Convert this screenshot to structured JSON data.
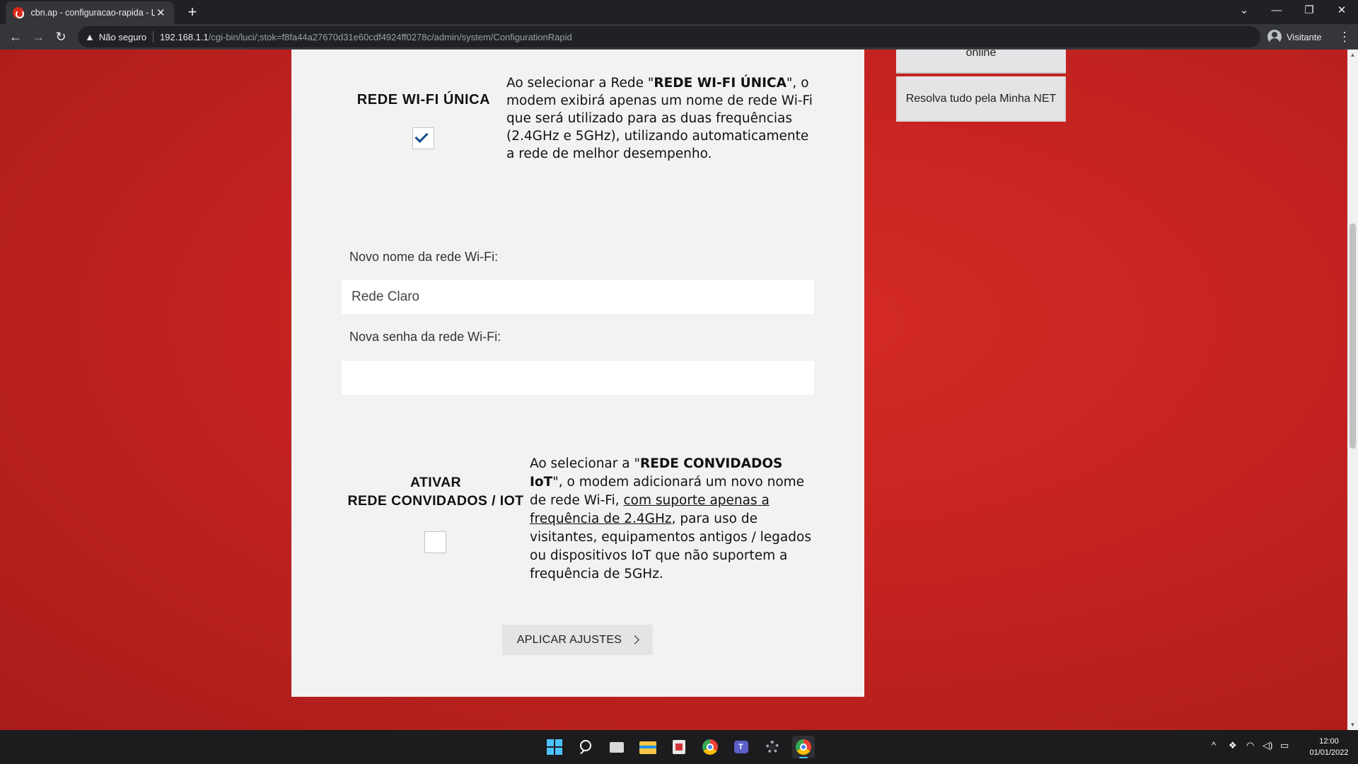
{
  "browser": {
    "tab_title": "cbn.ap - configuracao-rapida - LuCI",
    "tab_close": "✕",
    "new_tab": "+",
    "security_label": "Não seguro",
    "url_host": "192.168.1.1",
    "url_path": "/cgi-bin/luci/;stok=f8fa44a27670d31e60cdf4924ff0278c/admin/system/ConfigurationRapid",
    "profile_label": "Visitante"
  },
  "sidebar": {
    "top_item": "online",
    "link_label": "Resolva tudo pela Minha NET"
  },
  "unique_wifi": {
    "title": "REDE WI-FI ÚNICA",
    "checked": true,
    "desc_prefix": "Ao selecionar a Rede \"",
    "desc_bold": "REDE WI-FI ÚNICA",
    "desc_suffix": "\", o modem exibirá apenas um nome de rede Wi-Fi que será utilizado para as duas frequências (2.4GHz e 5GHz), utilizando automaticamente a rede de melhor desempenho."
  },
  "form": {
    "ssid_label": "Novo nome da rede Wi-Fi:",
    "ssid_value": "Rede Claro",
    "password_label": "Nova senha da rede Wi-Fi:",
    "password_value": ""
  },
  "guest_iot": {
    "title_line1": "ATIVAR",
    "title_line2": "REDE CONVIDADOS / IOT",
    "checked": false,
    "desc_prefix": "Ao selecionar a \"",
    "desc_bold": "REDE CONVIDADOS IoT",
    "desc_mid": "\", o modem adicionará um novo nome de rede Wi-Fi, ",
    "desc_underline": "com suporte apenas a frequência de 2.4GHz",
    "desc_suffix": ", para uso de visitantes, equipamentos antigos / legados ou dispositivos IoT que não suportem a frequência de 5GHz."
  },
  "apply_button": "APLICAR AJUSTES",
  "taskbar": {
    "time": "12:00",
    "date": "01/01/2022"
  },
  "colors": {
    "page_background": "#c42320",
    "card": "#f2f2f2",
    "check_mark": "#134a8e",
    "button": "#e4e4e6"
  }
}
